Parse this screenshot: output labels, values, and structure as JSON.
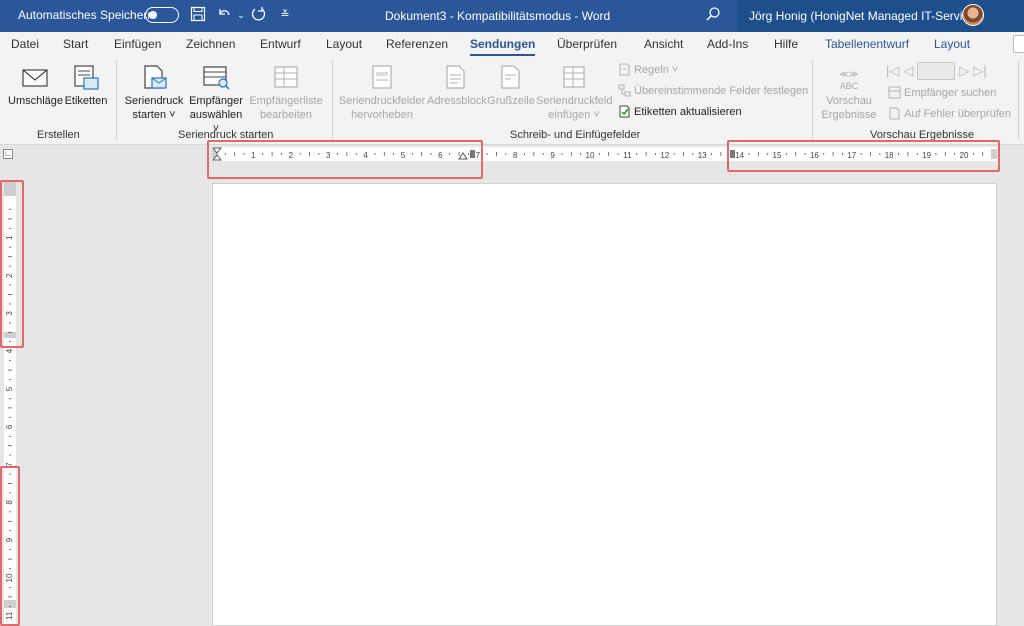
{
  "titlebar": {
    "autosave_label": "Automatisches Speichern",
    "document_title": "Dokument3  -  Kompatibilitätsmodus  -  Word",
    "user_name": "Jörg Honig (HonigNet Managed IT-Service)"
  },
  "tabs": [
    "Datei",
    "Start",
    "Einfügen",
    "Zeichnen",
    "Entwurf",
    "Layout",
    "Referenzen",
    "Sendungen",
    "Überprüfen",
    "Ansicht",
    "Add-Ins",
    "Hilfe",
    "Tabellenentwurf",
    "Layout"
  ],
  "ribbon": {
    "erstellen": {
      "label": "Erstellen",
      "umschlaege": "Umschläge",
      "etiketten": "Etiketten"
    },
    "seriendruck_starten": {
      "label": "Seriendruck starten",
      "seriendruck_l1": "Seriendruck",
      "seriendruck_l2": "starten",
      "empfaenger_l1": "Empfänger",
      "empfaenger_l2": "auswählen",
      "liste_l1": "Empfängerliste",
      "liste_l2": "bearbeiten"
    },
    "schreib_einfuege": {
      "label": "Schreib- und Einfügefelder",
      "hervorheben_l1": "Seriendruckfelder",
      "hervorheben_l2": "hervorheben",
      "adressblock": "Adressblock",
      "grusszeile": "Grußzeile",
      "feld_l1": "Seriendruckfeld",
      "feld_l2": "einfügen",
      "regeln": "Regeln",
      "felder_festlegen": "Übereinstimmende Felder festlegen",
      "etiketten_aktualisieren": "Etiketten aktualisieren"
    },
    "vorschau": {
      "label": "Vorschau Ergebnisse",
      "vorschau_l1": "Vorschau",
      "vorschau_l2": "Ergebnisse",
      "abc": "ABC",
      "empfaenger_suchen": "Empfänger suchen",
      "fehler": "Auf Fehler überprüfen"
    }
  },
  "ruler": {
    "h_numbers": [
      "1",
      "2",
      "3",
      "4",
      "5",
      "6",
      "7",
      "8",
      "9",
      "10",
      "11",
      "12",
      "13",
      "14",
      "15",
      "16",
      "17",
      "18",
      "19",
      "20"
    ],
    "v_numbers": [
      "1",
      "2",
      "3",
      "4",
      "5",
      "6",
      "7",
      "8",
      "9",
      "10",
      "11"
    ]
  },
  "colors": {
    "titlebar": "#2b579a",
    "highlight": "#e0696b"
  }
}
